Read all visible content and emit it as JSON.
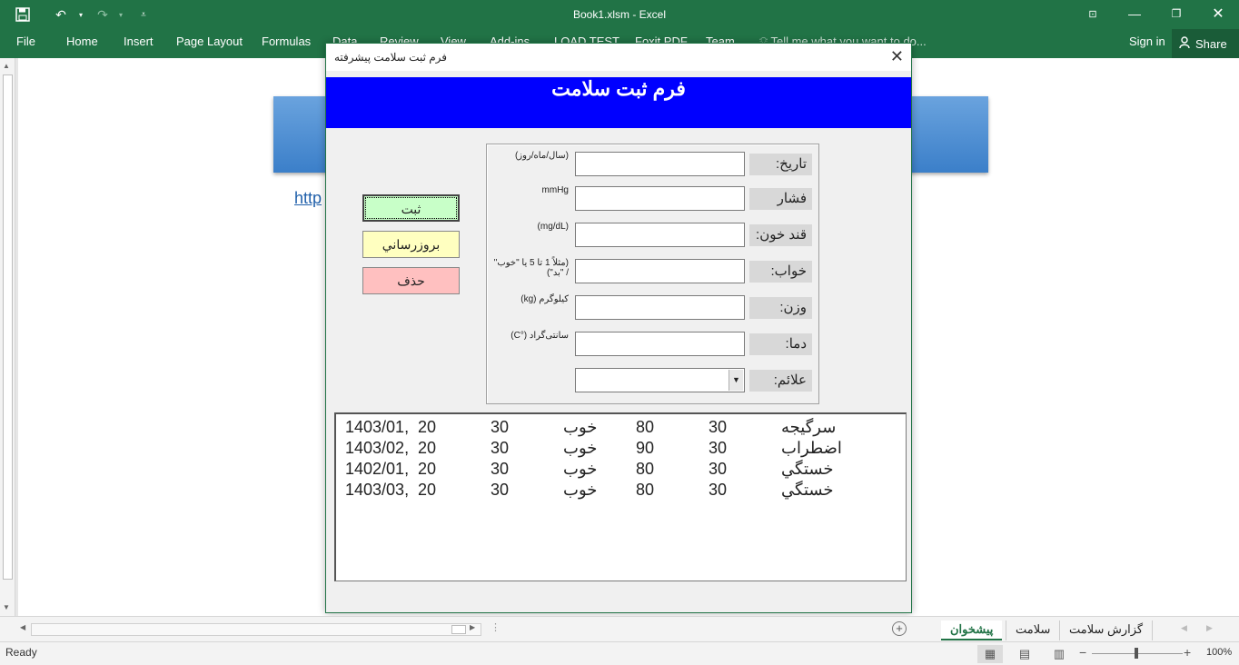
{
  "window": {
    "title": "Book1.xlsm - Excel",
    "tell_me": "Tell me what you want to do...",
    "sign_in": "Sign in",
    "share": "Share"
  },
  "ribbon": {
    "tabs": [
      "File",
      "Home",
      "Insert",
      "Page Layout",
      "Formulas",
      "Data",
      "Review",
      "View",
      "Add-ins",
      "LOAD TEST",
      "Foxit PDF",
      "Team"
    ]
  },
  "sheet": {
    "link_text": "http"
  },
  "dialog": {
    "title": "فرم ثبت سلامت پیشرفته",
    "header": "فرم ثبت سلامت",
    "buttons": {
      "save": "ثبت",
      "update": "بروزرساني",
      "delete": "حذف"
    },
    "fields": [
      {
        "label": "تاريخ:",
        "hint": "(سال/ماه/روز)",
        "value": ""
      },
      {
        "label": "فشار",
        "hint": "mmHg",
        "value": ""
      },
      {
        "label": "قند خون:",
        "hint": "(mg/dL)",
        "value": ""
      },
      {
        "label": "خواب:",
        "hint": "(مثلاً 1 تا 5 يا \"خوب\" / \"بد\")",
        "value": ""
      },
      {
        "label": "وزن:",
        "hint": "کیلوگرم (kg)",
        "value": ""
      },
      {
        "label": "دما:",
        "hint": "سانتی‌گراد (°C)",
        "value": ""
      },
      {
        "label": "علائم:",
        "hint": "",
        "value": ""
      }
    ],
    "records": [
      {
        "date": "1403/01,",
        "a": "20",
        "b": "30",
        "sleep": "خوب",
        "c": "80",
        "d": "30",
        "symptom": "سرگیجه"
      },
      {
        "date": "1403/02,",
        "a": "20",
        "b": "30",
        "sleep": "خوب",
        "c": "90",
        "d": "30",
        "symptom": "اضطراب"
      },
      {
        "date": "1402/01,",
        "a": "20",
        "b": "30",
        "sleep": "خوب",
        "c": "80",
        "d": "30",
        "symptom": "خستگي"
      },
      {
        "date": "1403/03,",
        "a": "20",
        "b": "30",
        "sleep": "خوب",
        "c": "80",
        "d": "30",
        "symptom": "خستگي"
      }
    ]
  },
  "sheet_tabs": [
    "پیشخوان",
    "سلامت",
    "گزارش سلامت"
  ],
  "status": {
    "ready": "Ready",
    "zoom": "100%"
  }
}
